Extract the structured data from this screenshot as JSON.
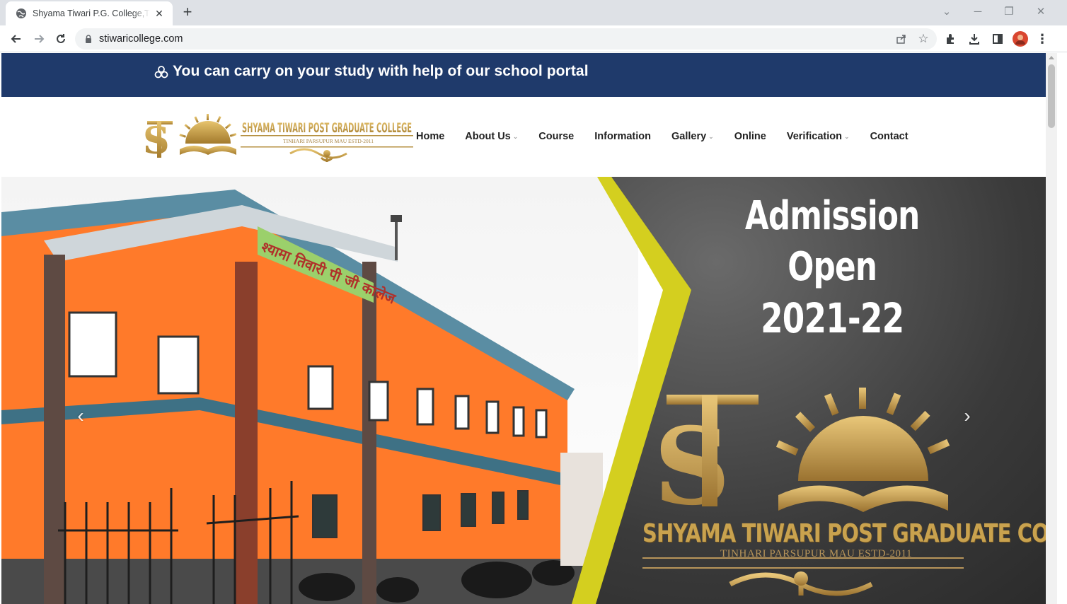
{
  "browser": {
    "tab_title": "Shyama Tiwari P.G. College,Tinhari",
    "url": "stiwaricollege.com"
  },
  "topbar": {
    "message": "You can carry on your study with help of our school portal",
    "icon": "triple-circle-icon"
  },
  "logo": {
    "name": "SHYAMA TIWARI POST GRADUATE COLLEGE",
    "sub": "TINHARI PARSUPUR MAU ESTD-2011"
  },
  "nav": {
    "items": [
      {
        "label": "Home",
        "dropdown": false
      },
      {
        "label": "About Us",
        "dropdown": true
      },
      {
        "label": "Course",
        "dropdown": false
      },
      {
        "label": "Information",
        "dropdown": false
      },
      {
        "label": "Gallery",
        "dropdown": true
      },
      {
        "label": "Online",
        "dropdown": false
      },
      {
        "label": "Verification",
        "dropdown": true
      },
      {
        "label": "Contact",
        "dropdown": false
      }
    ],
    "caret": "⌄"
  },
  "hero": {
    "title_line1": "Admission Open",
    "title_line2": "2021-22",
    "college_name": "SHYAMA TIWARI POST GRADUATE COLLEGE",
    "college_sub": "TINHARI PARSUPUR MAU ESTD-2011",
    "sign_text": "श्यामा तिवारी पी जी कालेज",
    "prev": "‹",
    "next": "›"
  },
  "colors": {
    "topbar_bg": "#1f3a6b",
    "gold": "#c9a24e",
    "accent_yellow": "#d4cf1f",
    "building_orange": "#ff7a2a"
  }
}
